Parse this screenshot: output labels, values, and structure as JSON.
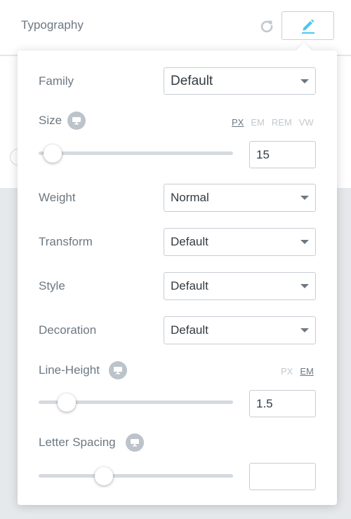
{
  "header": {
    "title": "Typography"
  },
  "family": {
    "label": "Family",
    "value": "Default"
  },
  "size": {
    "label": "Size",
    "units": [
      "PX",
      "EM",
      "REM",
      "VW"
    ],
    "active_unit": "PX",
    "value": "15"
  },
  "weight": {
    "label": "Weight",
    "value": "Normal"
  },
  "transform": {
    "label": "Transform",
    "value": "Default"
  },
  "style": {
    "label": "Style",
    "value": "Default"
  },
  "decoration": {
    "label": "Decoration",
    "value": "Default"
  },
  "line_height": {
    "label": "Line-Height",
    "units": [
      "PX",
      "EM"
    ],
    "active_unit": "EM",
    "value": "1.5"
  },
  "letter_spacing": {
    "label": "Letter Spacing",
    "value": ""
  },
  "colors": {
    "accent": "#4dc6ee",
    "text": "#6d7882",
    "input_text": "#333b42",
    "border": "#c7cdd3",
    "track": "#d5dadf",
    "responsive_icon_bg": "#bcc3ca",
    "backdrop": "#e6e9ec"
  },
  "icons": {
    "reset": "refresh-icon",
    "edit": "pencil-icon",
    "responsive": "desktop-monitor-icon",
    "dropdown": "caret-down-icon"
  }
}
